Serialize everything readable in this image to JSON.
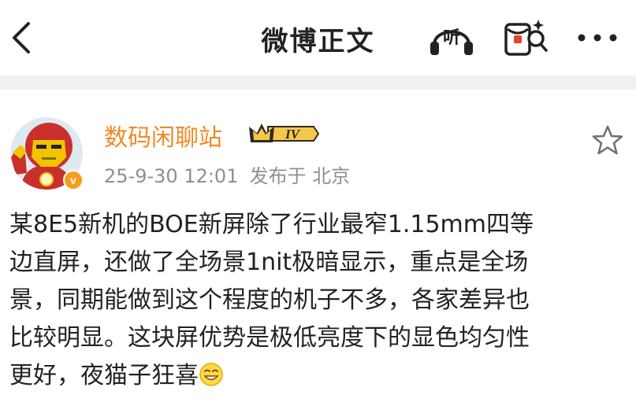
{
  "header": {
    "title": "微博正文",
    "back_icon": "chevron-left-icon",
    "listen_label": "听",
    "listen_icon": "headphones-icon",
    "redpacket_icon": "red-packet-icon",
    "more_icon": "more-dots-icon"
  },
  "post": {
    "author": {
      "name": "数码闲聊站",
      "level_badge": "IV",
      "verified_mark": "v",
      "verified_color": "#f59e1c"
    },
    "time": "25-9-30 12:01",
    "location": "发布于 北京",
    "star_icon": "star-outline-icon",
    "body_lines": [
      "某8E5新机的BOE新屏除了行业最窄1.15mm四等",
      "边直屏，还做了全场景1nit极暗显示，重点是全场",
      "景，同期能做到这个程度的机子不多，各家差异也",
      "比较明显。这块屏优势是极低亮度下的显色均匀性",
      "更好，夜猫子狂喜"
    ],
    "trailing_emoji": "grin-emoji-icon"
  },
  "colors": {
    "author_name": "#f08a24",
    "meta_text": "#8f8f8f",
    "body_text": "#222222",
    "divider": "#f1f1f1",
    "accent_red": "#e8412c"
  }
}
